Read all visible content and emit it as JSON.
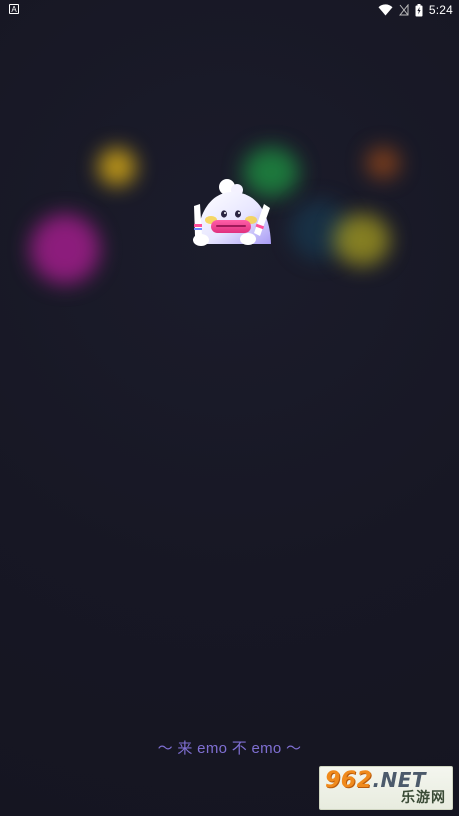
{
  "status_bar": {
    "left_icon": "A",
    "time": "5:24",
    "icons": [
      "wifi-icon",
      "signal-icon",
      "battery-icon"
    ]
  },
  "mascot": {
    "icon": "emo-ghost-mascot-icon"
  },
  "tagline": "～ 来 emo 不 emo ～",
  "watermark": {
    "number": "962",
    "suffix": ".NET",
    "site_name": "乐游网"
  },
  "colors": {
    "background": "#171724",
    "tagline": "#7f6fd2",
    "watermark_orange": "#f08a1c"
  }
}
